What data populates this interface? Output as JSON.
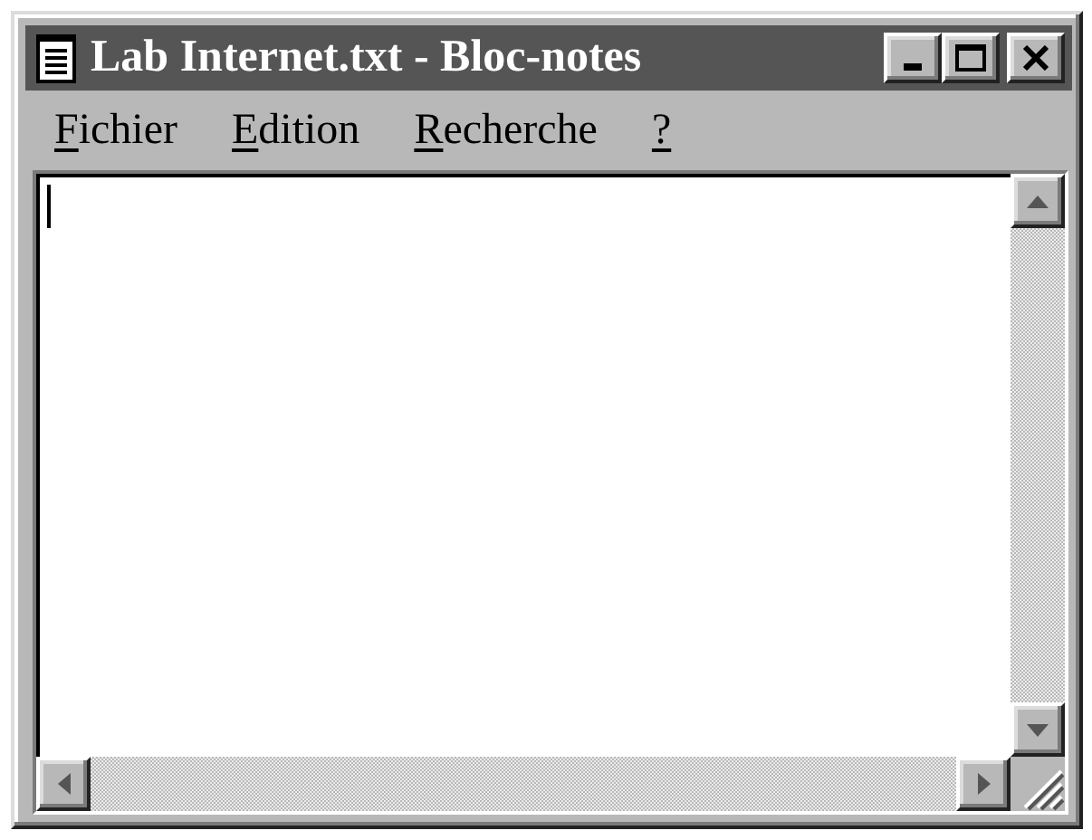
{
  "window": {
    "title": "Lab Internet.txt - Bloc-notes",
    "active": true
  },
  "menu": [
    {
      "label": "Fichier",
      "underline_first": true
    },
    {
      "label": "Edition",
      "underline_first": true
    },
    {
      "label": "Recherche",
      "underline_first": true
    },
    {
      "label": "?",
      "underline_first": true
    }
  ]
}
